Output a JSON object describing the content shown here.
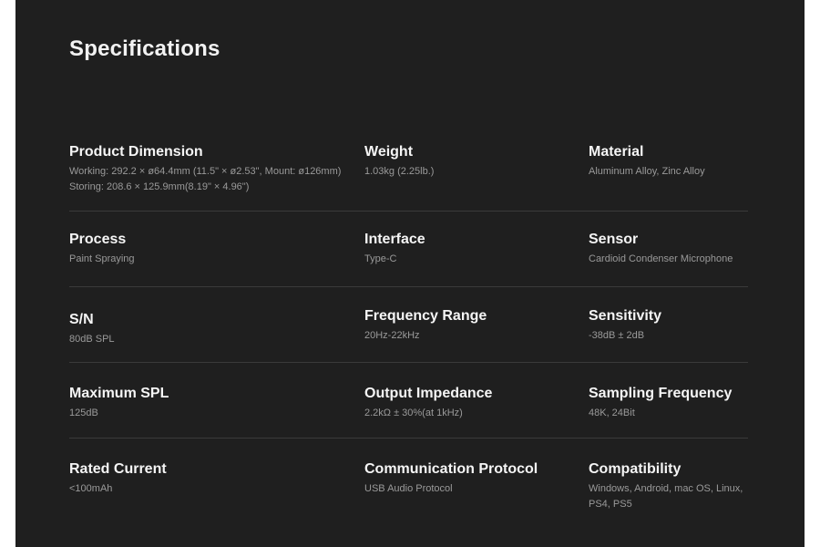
{
  "title": "Specifications",
  "rows": [
    [
      {
        "label": "Product Dimension",
        "value": "Working: 292.2 × ø64.4mm (11.5\" × ø2.53\", Mount: ø126mm)\nStoring: 208.6 × 125.9mm(8.19\" × 4.96\")"
      },
      {
        "label": "Weight",
        "value": "1.03kg (2.25lb.)"
      },
      {
        "label": "Material",
        "value": "Aluminum Alloy, Zinc Alloy"
      }
    ],
    [
      {
        "label": "Process",
        "value": "Paint Spraying"
      },
      {
        "label": "Interface",
        "value": "Type-C"
      },
      {
        "label": "Sensor",
        "value": "Cardioid Condenser Microphone"
      }
    ],
    [
      {
        "label": "S/N",
        "value": "80dB SPL"
      },
      {
        "label": "Frequency Range",
        "value": "20Hz-22kHz"
      },
      {
        "label": "Sensitivity",
        "value": "-38dB ± 2dB"
      }
    ],
    [
      {
        "label": "Maximum SPL",
        "value": "125dB"
      },
      {
        "label": "Output Impedance",
        "value": "2.2kΩ ± 30%(at 1kHz)"
      },
      {
        "label": "Sampling Frequency",
        "value": "48K, 24Bit"
      }
    ],
    [
      {
        "label": "Rated Current",
        "value": "<100mAh"
      },
      {
        "label": "Communication Protocol",
        "value": "USB Audio Protocol"
      },
      {
        "label": "Compatibility",
        "value": "Windows, Android, mac OS, Linux,\nPS4, PS5"
      }
    ]
  ]
}
